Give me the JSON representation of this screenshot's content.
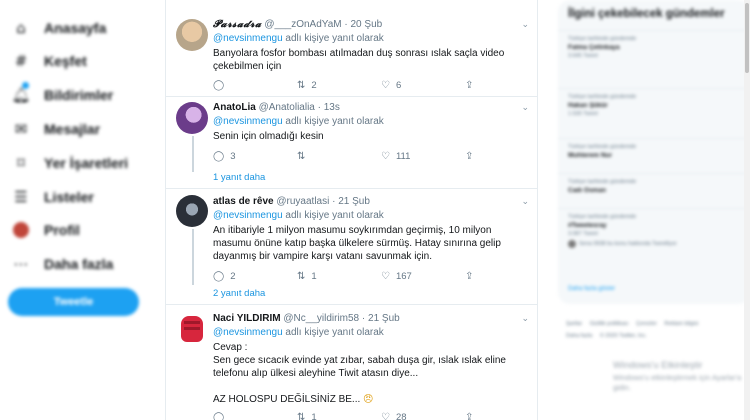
{
  "nav": {
    "items": [
      {
        "label": "Anasayfa",
        "icon": "home-icon"
      },
      {
        "label": "Keşfet",
        "icon": "hashtag-icon"
      },
      {
        "label": "Bildirimler",
        "icon": "bell-icon"
      },
      {
        "label": "Mesajlar",
        "icon": "mail-icon"
      },
      {
        "label": "Yer İşaretleri",
        "icon": "bookmark-icon"
      },
      {
        "label": "Listeler",
        "icon": "list-icon"
      },
      {
        "label": "Profil",
        "icon": "profile-avatar"
      },
      {
        "label": "Daha fazla",
        "icon": "more-icon"
      }
    ],
    "tweet_button": "Tweetle",
    "accent": "#1da1f2"
  },
  "tweets": [
    {
      "display_name": "𝓟𝓪𝓻𝓼𝓪𝓭𝓻𝓪",
      "handle": "@___zOnAdYaM",
      "time": "· 20 Şub",
      "replying_mention": "@nevsinmengu",
      "replying_suffix": " adlı kişiye yanıt olarak",
      "text": "Banyolara fosfor bombası atılmadan duş sonrası ıslak saçla video çekebilmen için",
      "replies": "",
      "retweets": "2",
      "likes": "6"
    },
    {
      "display_name": "AnatoLia",
      "handle": "@Anatolialia",
      "time": "· 13s",
      "replying_mention": "@nevsinmengu",
      "replying_suffix": " adlı kişiye yanıt olarak",
      "text": "Senin için olmadığı kesin",
      "replies": "3",
      "retweets": "",
      "likes": "111",
      "more_replies": "1 yanıt daha"
    },
    {
      "display_name": "atlas de rêve",
      "handle": "@ruyaatlasi",
      "time": "· 21 Şub",
      "replying_mention": "@nevsinmengu",
      "replying_suffix": " adlı kişiye yanıt olarak",
      "text": "An itibariyle 1 milyon masumu soykırımdan geçirmiş, 10 milyon masumu önüne katıp başka ülkelere sürmüş. Hatay sınırına gelip dayanmış bir vampire karşı vatanı savunmak için.",
      "replies": "2",
      "retweets": "1",
      "likes": "167",
      "more_replies": "2 yanıt daha"
    },
    {
      "display_name": "Naci YILDIRIM",
      "handle": "@Nc__yildirim58",
      "time": "· 21 Şub",
      "replying_mention": "@nevsinmengu",
      "replying_suffix": " adlı kişiye yanıt olarak",
      "text_lines": [
        "Cevap :",
        "Sen gece sıcacık evinde yat zıbar, sabah duşa gir, ıslak ıslak eline telefonu alıp ülkesi aleyhine Tiwit atasın diye..."
      ],
      "text_last": "AZ HOLOSPU DEĞİLSİNİZ BE...",
      "emoji": "😠",
      "replies": "",
      "retweets": "1",
      "likes": "28"
    }
  ],
  "sidebar": {
    "title": "İlgini çekebilecek gündemler",
    "trends": [
      {
        "context": "Türkiye tarihinde gündemde",
        "name": "Fatma Çetinkaya",
        "count": "3.645 Tweet"
      },
      {
        "context": "Türkiye tarihinde gündemde",
        "name": "Hakan Şükür",
        "count": "1.530 Tweet"
      },
      {
        "context": "Türkiye tarihinde gündemde",
        "name": "Muhterem Nur",
        "count": ""
      },
      {
        "context": "Türkiye tarihinde gündemde",
        "name": "Cadı Osman",
        "count": ""
      },
      {
        "context": "Türkiye tarihinde gündemde",
        "name": "#Tweetesray",
        "count": "3.087 Tweet",
        "from": "Sena 0938 bu konu hakkında Tweetliyor"
      }
    ],
    "show_more": "Daha fazla göster",
    "footer_row1": [
      "Şartlar",
      "Gizlilik politikası",
      "Çerezler",
      "Reklam bilgisi"
    ],
    "footer_row2": [
      "Daha fazla",
      "© 2020 Twitter, Inc."
    ]
  },
  "watermark": {
    "line1": "Windows'u Etkinleştir",
    "line2": "Windows'u etkinleştirmek için Ayarlar'a gidin."
  },
  "icons": {
    "reply": "reply-icon",
    "retweet": "retweet-icon",
    "like": "heart-icon",
    "share": "share-icon",
    "caret": "caret-down-icon"
  }
}
